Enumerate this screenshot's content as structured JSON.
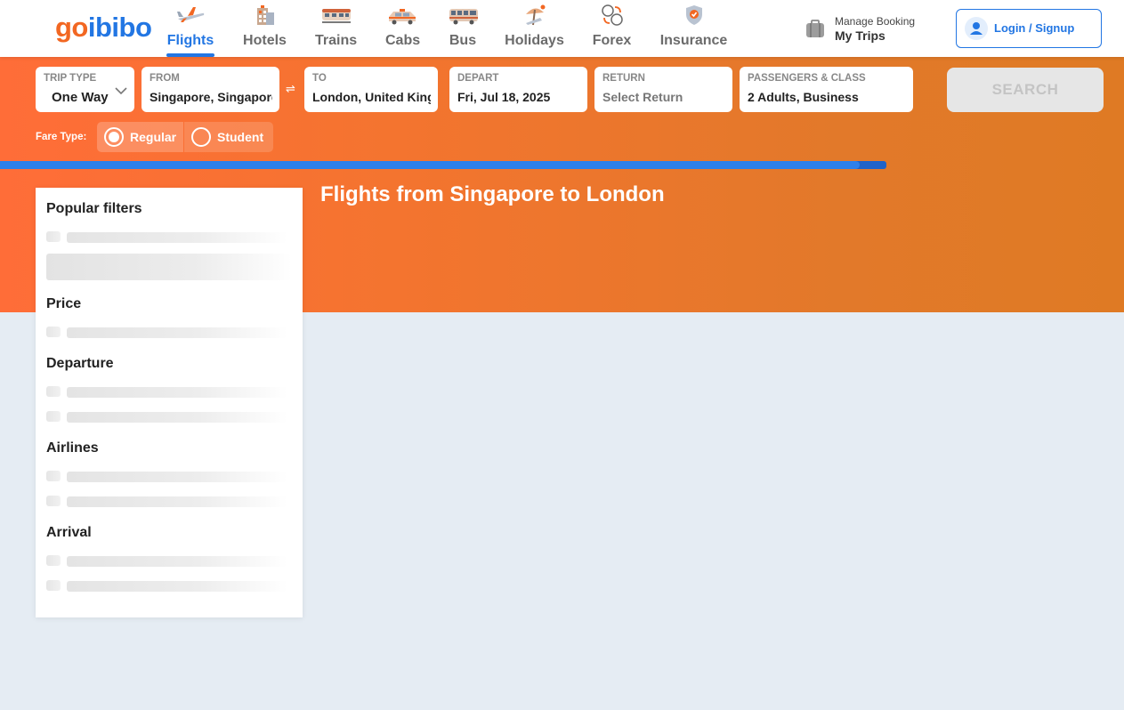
{
  "brand": {
    "logo_go": "go",
    "logo_ibibo": "ibibo"
  },
  "nav": [
    {
      "label": "Flights",
      "icon": "plane-icon",
      "active": true
    },
    {
      "label": "Hotels",
      "icon": "hotel-icon"
    },
    {
      "label": "Trains",
      "icon": "train-icon"
    },
    {
      "label": "Cabs",
      "icon": "cab-icon"
    },
    {
      "label": "Bus",
      "icon": "bus-icon"
    },
    {
      "label": "Holidays",
      "icon": "holidays-icon"
    },
    {
      "label": "Forex",
      "icon": "forex-icon"
    },
    {
      "label": "Insurance",
      "icon": "insurance-shield-icon"
    }
  ],
  "manage_booking": {
    "line1": "Manage Booking",
    "line2": "My Trips",
    "icon": "briefcase-icon"
  },
  "login": {
    "label": "Login / Signup",
    "icon": "user-icon"
  },
  "search_form": {
    "trip_type": {
      "label": "TRIP TYPE",
      "value": "One Way"
    },
    "from": {
      "label": "FROM",
      "value": "Singapore, Singapore"
    },
    "swap_icon": "⇌",
    "to": {
      "label": "TO",
      "value": "London, United Kingdom"
    },
    "depart": {
      "label": "DEPART",
      "value": "Fri, Jul 18, 2025"
    },
    "return": {
      "label": "RETURN",
      "value": "Select Return"
    },
    "passengers": {
      "label": "PASSENGERS & CLASS",
      "value": "2 Adults, Business"
    },
    "search_button": "SEARCH"
  },
  "fare_type": {
    "label": "Fare Type:",
    "options": [
      {
        "label": "Regular",
        "selected": true
      },
      {
        "label": "Student",
        "selected": false
      }
    ]
  },
  "loading_progress": 0.97,
  "page_title": "Flights from Singapore to London",
  "filters": {
    "sections": [
      {
        "title": "Popular filters"
      },
      {
        "title": "Price"
      },
      {
        "title": "Departure"
      },
      {
        "title": "Airlines"
      },
      {
        "title": "Arrival"
      }
    ]
  },
  "colors": {
    "brand_orange": "#f26722",
    "brand_blue": "#2276e3",
    "hero_orange": "#f4742f",
    "page_bg": "#e5ecf3"
  }
}
